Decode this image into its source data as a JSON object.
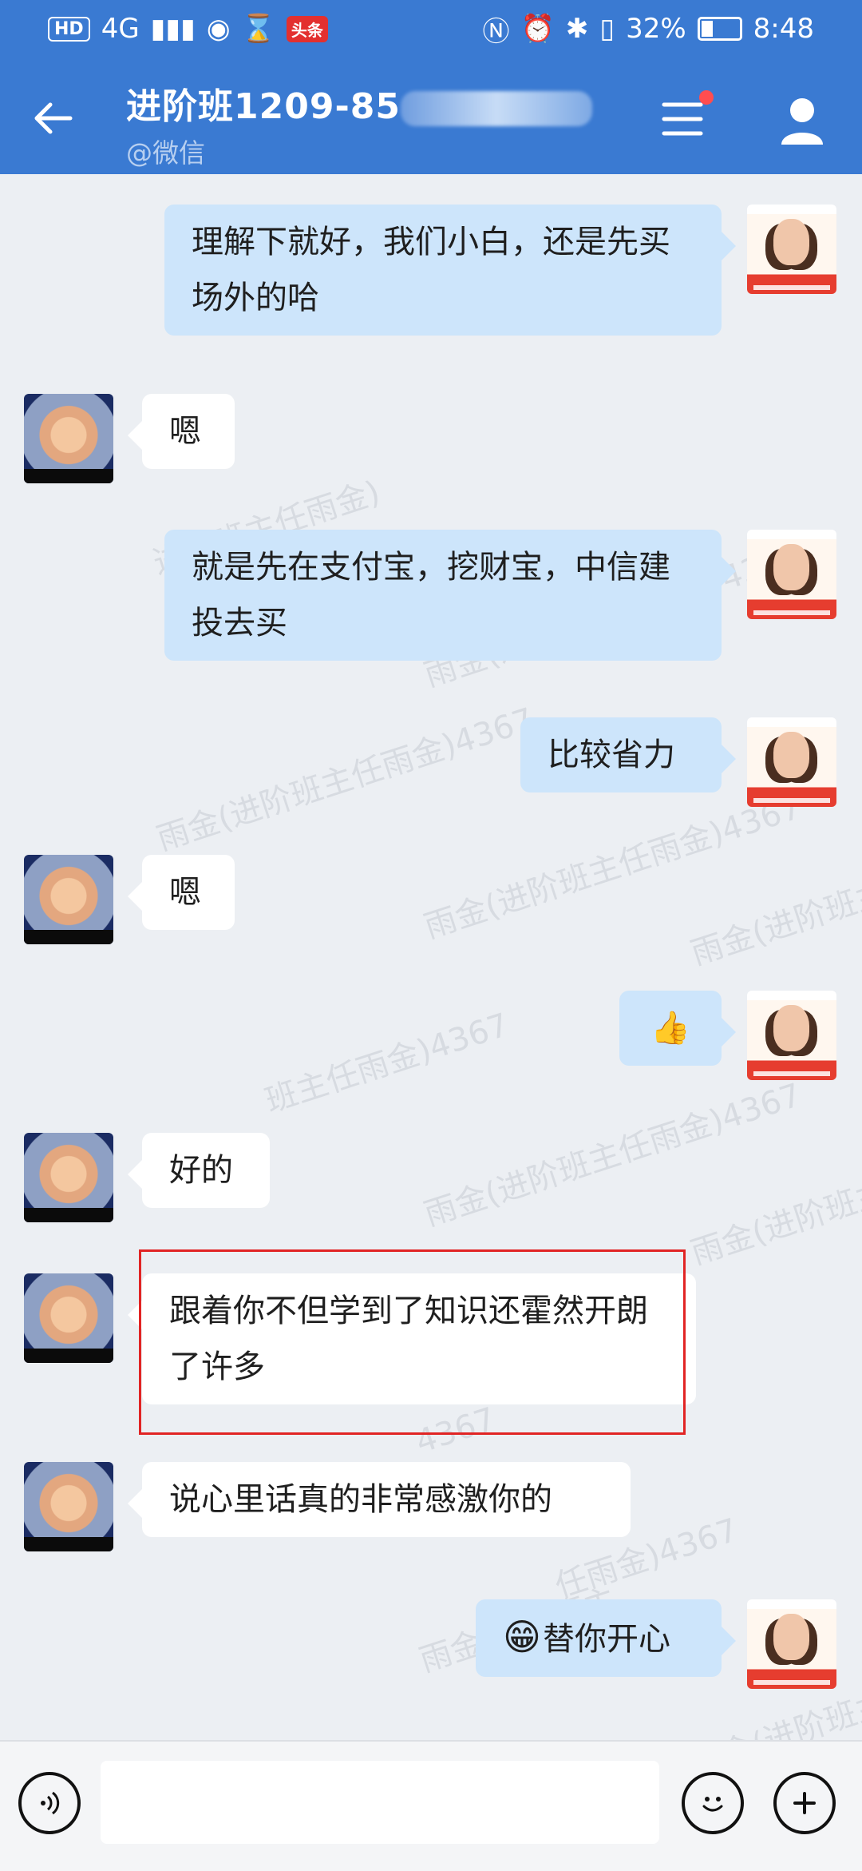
{
  "status_bar": {
    "left": {
      "hd": "HD",
      "network": "4G",
      "app_badge": "头条"
    },
    "right": {
      "battery": "32%",
      "time": "8:48"
    }
  },
  "header": {
    "title_visible": "进阶班1209-85",
    "subtitle": "@微信"
  },
  "watermarks": [
    "进阶班主任雨金)",
    "雨金(进阶班主任雨金)4367",
    "雨金(进阶班主任雨金)4367",
    "雨金(进阶班主任雨金)4367",
    "雨金(进阶班主",
    "班主任雨金)4367",
    "雨金(进阶班主任雨金)4367",
    "雨金(进阶班主",
    "4367",
    "任雨金)4367",
    "雨金(进阶班主",
    "雨金(进阶班主"
  ],
  "messages": [
    {
      "side": "right",
      "text": "理解下就好，我们小白，还是先买场外的哈"
    },
    {
      "side": "left",
      "text": "嗯"
    },
    {
      "side": "right",
      "text": "就是先在支付宝，挖财宝，中信建投去买"
    },
    {
      "side": "right",
      "text": "比较省力"
    },
    {
      "side": "left",
      "text": "嗯"
    },
    {
      "side": "right",
      "text": "👍"
    },
    {
      "side": "left",
      "text": "好的"
    },
    {
      "side": "left",
      "text": "跟着你不但学到了知识还霍然开朗了许多"
    },
    {
      "side": "left",
      "text": "说心里话真的非常感激你的"
    },
    {
      "side": "right",
      "emoji": "😁",
      "text": "替你开心"
    }
  ],
  "input_bar": {
    "placeholder": ""
  },
  "colors": {
    "primary": "#3a7ad2",
    "bubble_right": "#cde5fb",
    "bubble_left": "#ffffff",
    "highlight": "#e12424"
  },
  "icons": {
    "back": "arrow-left-icon",
    "menu": "menu-icon",
    "profile": "user-icon",
    "voice": "voice-icon",
    "emoji": "emoji-icon",
    "add": "plus-icon"
  }
}
